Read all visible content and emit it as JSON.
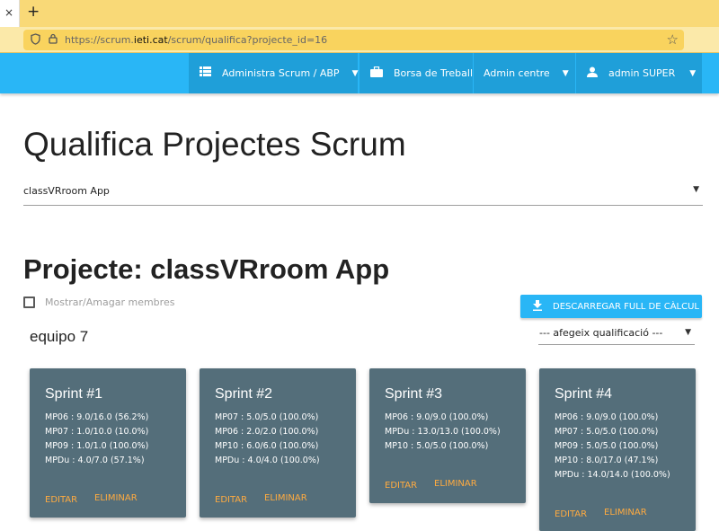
{
  "browser": {
    "tab_close": "×",
    "new_tab": "+",
    "url_prefix": "https://scrum.",
    "url_domain": "ieti.cat",
    "url_suffix": "/scrum/qualifica?projecte_id=16"
  },
  "navbar": {
    "items": [
      {
        "label": "Administra Scrum / ABP",
        "icon": "list-icon"
      },
      {
        "label": "Borsa de Treball",
        "icon": "briefcase-icon"
      },
      {
        "label": "Admin centre"
      },
      {
        "label": "admin SUPER",
        "icon": "person-icon"
      }
    ],
    "color": "#29b6f6"
  },
  "page": {
    "title": "Qualifica Projectes Scrum",
    "project_select": "classVRroom App",
    "project_title": "Projecte: classVRroom App",
    "members_toggle_label": "Mostrar/Amagar membres",
    "download_label": "DESCARREGAR FULL DE CÀLCUL",
    "team_name": "equipo 7",
    "grade_select_placeholder": "--- afegeix qualificació ---"
  },
  "sprints": [
    {
      "title": "Sprint #1",
      "lines": [
        "MP06 : 9.0/16.0 (56.2%)",
        "MP07 : 1.0/10.0 (10.0%)",
        "MP09 : 1.0/1.0 (100.0%)",
        "MPDu : 4.0/7.0 (57.1%)"
      ],
      "edit": "EDITAR",
      "delete": "ELIMINAR"
    },
    {
      "title": "Sprint #2",
      "lines": [
        "MP07 : 5.0/5.0 (100.0%)",
        "MP06 : 2.0/2.0 (100.0%)",
        "MP10 : 6.0/6.0 (100.0%)",
        "MPDu : 4.0/4.0 (100.0%)"
      ],
      "edit": "EDITAR",
      "delete": "ELIMINAR"
    },
    {
      "title": "Sprint #3",
      "lines": [
        "MP06 : 9.0/9.0 (100.0%)",
        "MPDu : 13.0/13.0 (100.0%)",
        "MP10 : 5.0/5.0 (100.0%)"
      ],
      "edit": "EDITAR",
      "delete": "ELIMINAR"
    },
    {
      "title": "Sprint #4",
      "lines": [
        "MP06 : 9.0/9.0 (100.0%)",
        "MP07 : 5.0/5.0 (100.0%)",
        "MP09 : 5.0/5.0 (100.0%)",
        "MP10 : 8.0/17.0 (47.1%)",
        "MPDu : 14.0/14.0 (100.0%)"
      ],
      "edit": "EDITAR",
      "delete": "ELIMINAR"
    }
  ],
  "colors": {
    "card": "#546e7a",
    "action": "#ffab40",
    "accent": "#29b6f6"
  }
}
